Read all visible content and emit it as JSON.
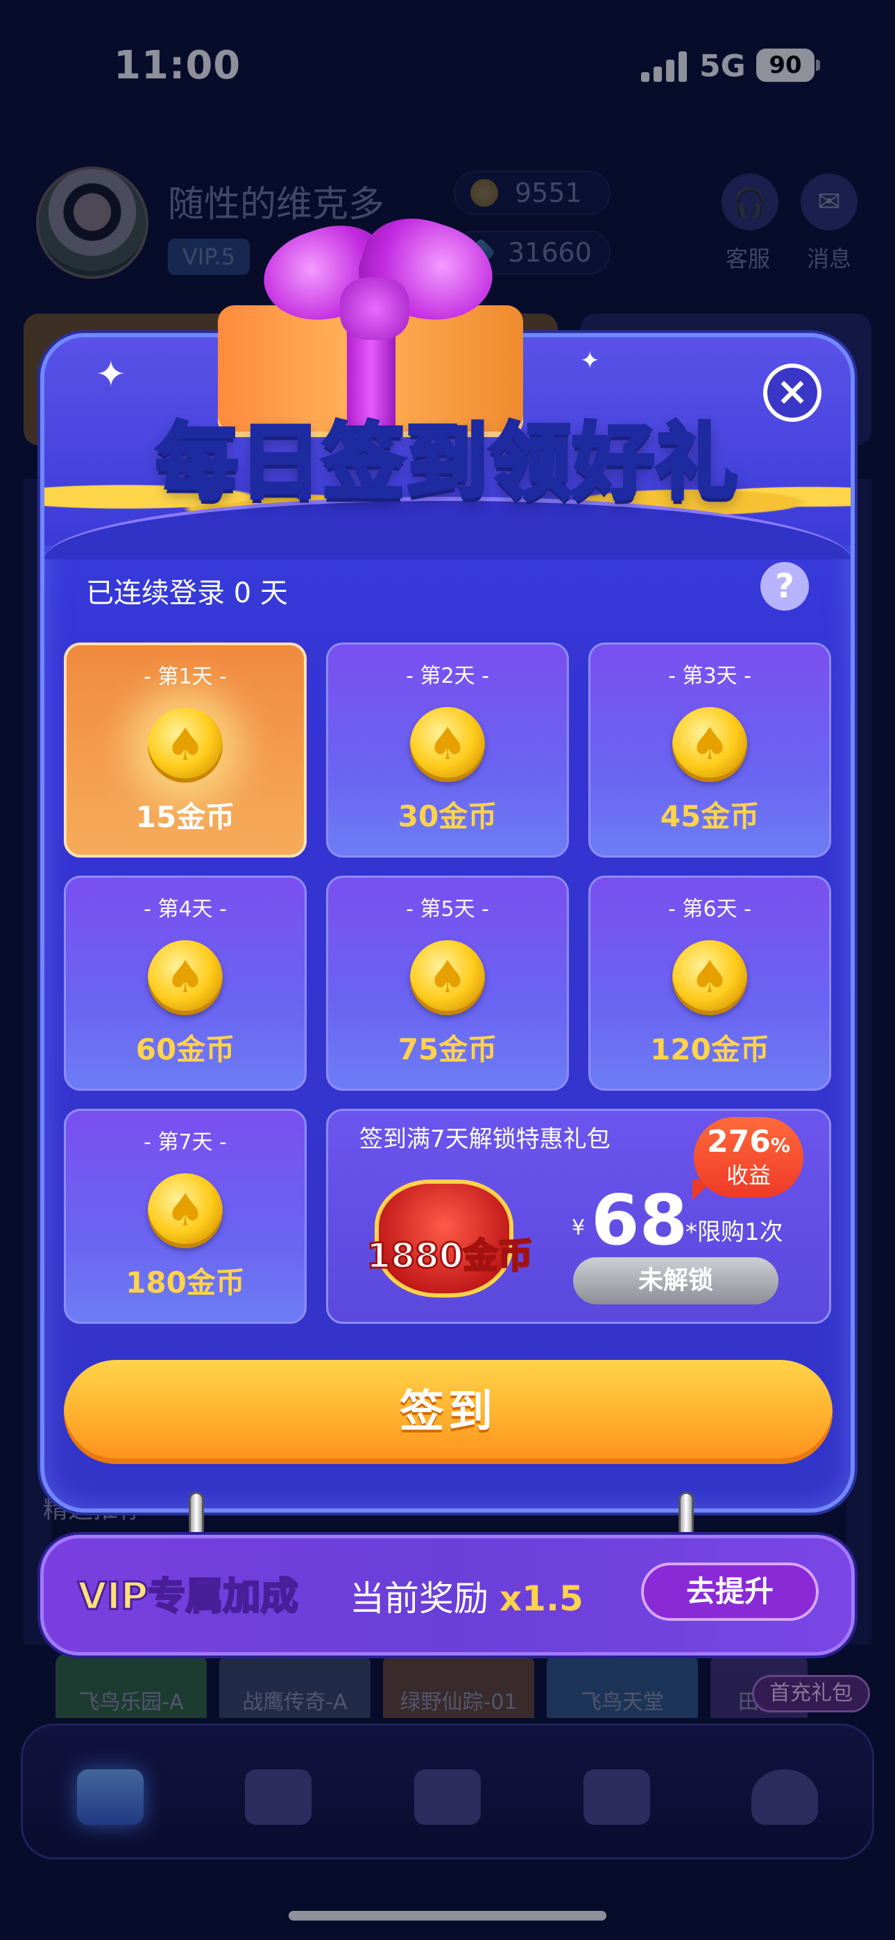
{
  "status": {
    "time": "11:00",
    "network": "5G",
    "battery": "90"
  },
  "profile": {
    "username": "随性的维克多",
    "vip": "VIP.5",
    "coins": "9551",
    "diamonds": "31660"
  },
  "header_buttons": {
    "service": "客服",
    "messages": "消息"
  },
  "modal": {
    "title_main": "每日签到",
    "title_highlight": "领好礼",
    "close_icon": "close-icon",
    "streak": "已连续登录 0 天",
    "help": "?",
    "days": [
      {
        "label": "- 第1天 -",
        "reward": "15金币",
        "state": "today"
      },
      {
        "label": "- 第2天 -",
        "reward": "30金币",
        "state": "pending"
      },
      {
        "label": "- 第3天 -",
        "reward": "45金币",
        "state": "pending"
      },
      {
        "label": "- 第4天 -",
        "reward": "60金币",
        "state": "pending"
      },
      {
        "label": "- 第5天 -",
        "reward": "75金币",
        "state": "pending"
      },
      {
        "label": "- 第6天 -",
        "reward": "120金币",
        "state": "pending"
      },
      {
        "label": "- 第7天 -",
        "reward": "180金币",
        "state": "pending"
      }
    ],
    "pack": {
      "title": "签到满7天解锁特惠礼包",
      "bag_text": "1880金币",
      "currency": "¥",
      "price": "68",
      "limit": "*限购1次",
      "bubble_pct": "276",
      "bubble_pct_unit": "%",
      "bubble_gain": "收益",
      "locked": "未解锁"
    },
    "signin_button": "签到"
  },
  "vip_bar": {
    "label": "VIP专属加成",
    "reward_prefix": "当前奖励",
    "reward_value": "x1.5",
    "upgrade": "去提升"
  },
  "background": {
    "featured": "精选推荐",
    "games": [
      "飞鸟乐园-A",
      "战鹰传奇-A",
      "绿野仙踪-01",
      "飞鸟天堂",
      "田园"
    ],
    "first_charge": "首充礼包"
  },
  "colors": {
    "accent_gold": "#ffd34a",
    "modal_blue": "#3534d4",
    "today_orange": "#f08a3e",
    "signin_orange": "#ffb02e"
  }
}
